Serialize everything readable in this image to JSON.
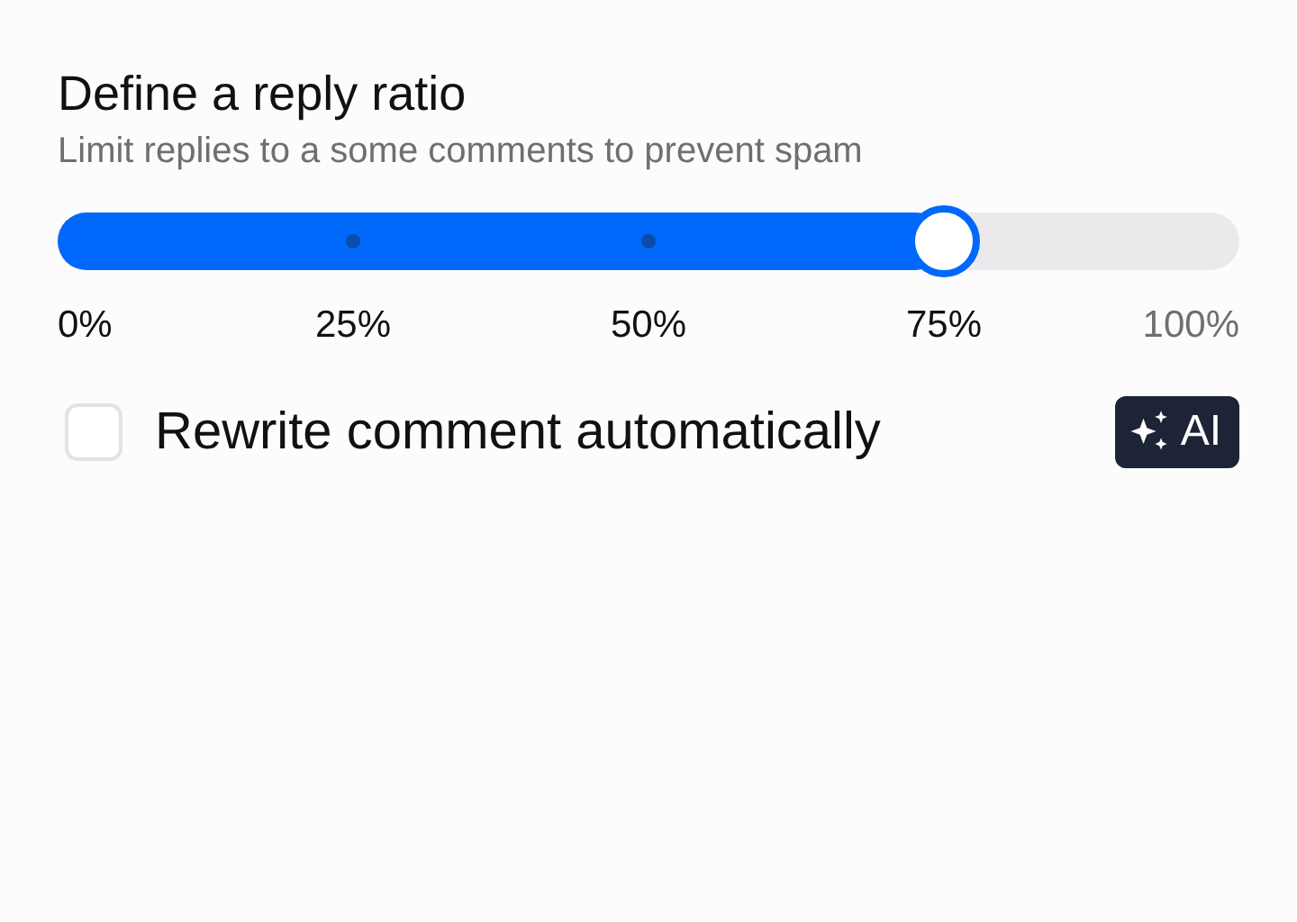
{
  "title": "Define a reply ratio",
  "subtitle": "Limit replies to a some comments to prevent spam",
  "slider": {
    "level": 0.75,
    "ticks": [
      "0%",
      "25%",
      "50%",
      "75%",
      "100%"
    ]
  },
  "option": {
    "label": "Rewrite comment automatically",
    "checked": false,
    "badge": "AI"
  }
}
